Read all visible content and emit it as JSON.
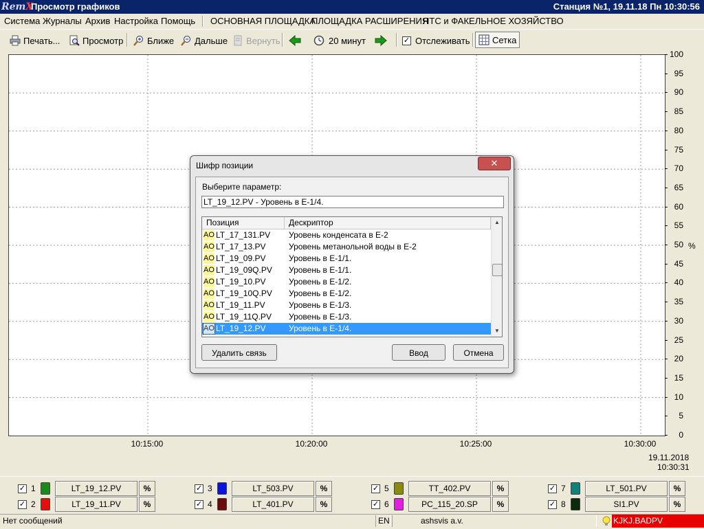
{
  "titlebar": {
    "logo_main": "Rem",
    "logo_x": "X",
    "title": "Просмотр графиков",
    "station": "Станция №1, 19.11.18 Пн 10:30:56"
  },
  "menu": {
    "items": [
      "Система",
      "Журналы",
      "Архив",
      "Настройка",
      "Помощь"
    ],
    "areas": [
      "ОСНОВНАЯ ПЛОЩАДКА",
      "ПЛОЩАДКА РАСШИРЕНИЯ",
      "НТС и ФАКЕЛЬНОЕ ХОЗЯЙСТВО"
    ]
  },
  "toolbar": {
    "print": "Печать...",
    "preview": "Просмотр",
    "zoom_in": "Ближе",
    "zoom_out": "Дальше",
    "restore": "Вернуть",
    "period": "20 минут",
    "track": "Отслеживать",
    "track_checked": true,
    "grid": "Сетка"
  },
  "chart_data": {
    "type": "line",
    "title": "",
    "ylabel": "%",
    "ylim": [
      0,
      100
    ],
    "yticks": [
      "100",
      "95",
      "90",
      "85",
      "80",
      "75",
      "70",
      "65",
      "60",
      "55",
      "50",
      "45",
      "40",
      "35",
      "30",
      "25",
      "20",
      "15",
      "10",
      "5",
      "0"
    ],
    "xticks": [
      "10:15:00",
      "10:20:00",
      "10:25:00",
      "10:30:00"
    ],
    "x_end_date": "19.11.2018",
    "x_end_time": "10:30:31",
    "grid": true,
    "series": []
  },
  "legend": {
    "entries": [
      {
        "num": "1",
        "tag": "LT_19_12.PV",
        "unit": "%",
        "color": "#1a8a1a"
      },
      {
        "num": "2",
        "tag": "LT_19_11.PV",
        "unit": "%",
        "color": "#e01010"
      },
      {
        "num": "3",
        "tag": "LT_503.PV",
        "unit": "%",
        "color": "#0a14e0"
      },
      {
        "num": "4",
        "tag": "LT_401.PV",
        "unit": "%",
        "color": "#6a0a0a"
      },
      {
        "num": "5",
        "tag": "TT_402.PV",
        "unit": "%",
        "color": "#8a8a10"
      },
      {
        "num": "6",
        "tag": "PC_115_20.SP",
        "unit": "%",
        "color": "#e020e0"
      },
      {
        "num": "7",
        "tag": "LT_501.PV",
        "unit": "%",
        "color": "#10807a"
      },
      {
        "num": "8",
        "tag": "SI1.PV",
        "unit": "%",
        "color": "#0a2a0a"
      }
    ]
  },
  "statusbar": {
    "message": "Нет сообщений",
    "lang": "EN",
    "user": "ashsvis a.v.",
    "alarm": "KJKJ.BADPV"
  },
  "dialog": {
    "title": "Шифр позиции",
    "close": "✕",
    "prompt": "Выберите параметр:",
    "input_value": "LT_19_12.PV - Уровень в Е-1/4.",
    "col_position": "Позиция",
    "col_descriptor": "Дескриптор",
    "rows": [
      {
        "type": "AO",
        "pos": "LT_17_131.PV",
        "desc": "Уровень конденсата в Е-2"
      },
      {
        "type": "AO",
        "pos": "LT_17_13.PV",
        "desc": "Уровень метанольной воды в Е-2"
      },
      {
        "type": "AO",
        "pos": "LT_19_09.PV",
        "desc": "Уровень в Е-1/1."
      },
      {
        "type": "AO",
        "pos": "LT_19_09Q.PV",
        "desc": "Уровень в Е-1/1."
      },
      {
        "type": "AO",
        "pos": "LT_19_10.PV",
        "desc": "Уровень в Е-1/2."
      },
      {
        "type": "AO",
        "pos": "LT_19_10Q.PV",
        "desc": "Уровень в Е-1/2."
      },
      {
        "type": "AO",
        "pos": "LT_19_11.PV",
        "desc": "Уровень в Е-1/3."
      },
      {
        "type": "AO",
        "pos": "LT_19_11Q.PV",
        "desc": "Уровень в Е-1/3."
      },
      {
        "type": "AO",
        "pos": "LT_19_12.PV",
        "desc": "Уровень в Е-1/4."
      }
    ],
    "selected_index": 8,
    "unlink_button": "Удалить связь",
    "ok_button": "Ввод",
    "cancel_button": "Отмена"
  }
}
